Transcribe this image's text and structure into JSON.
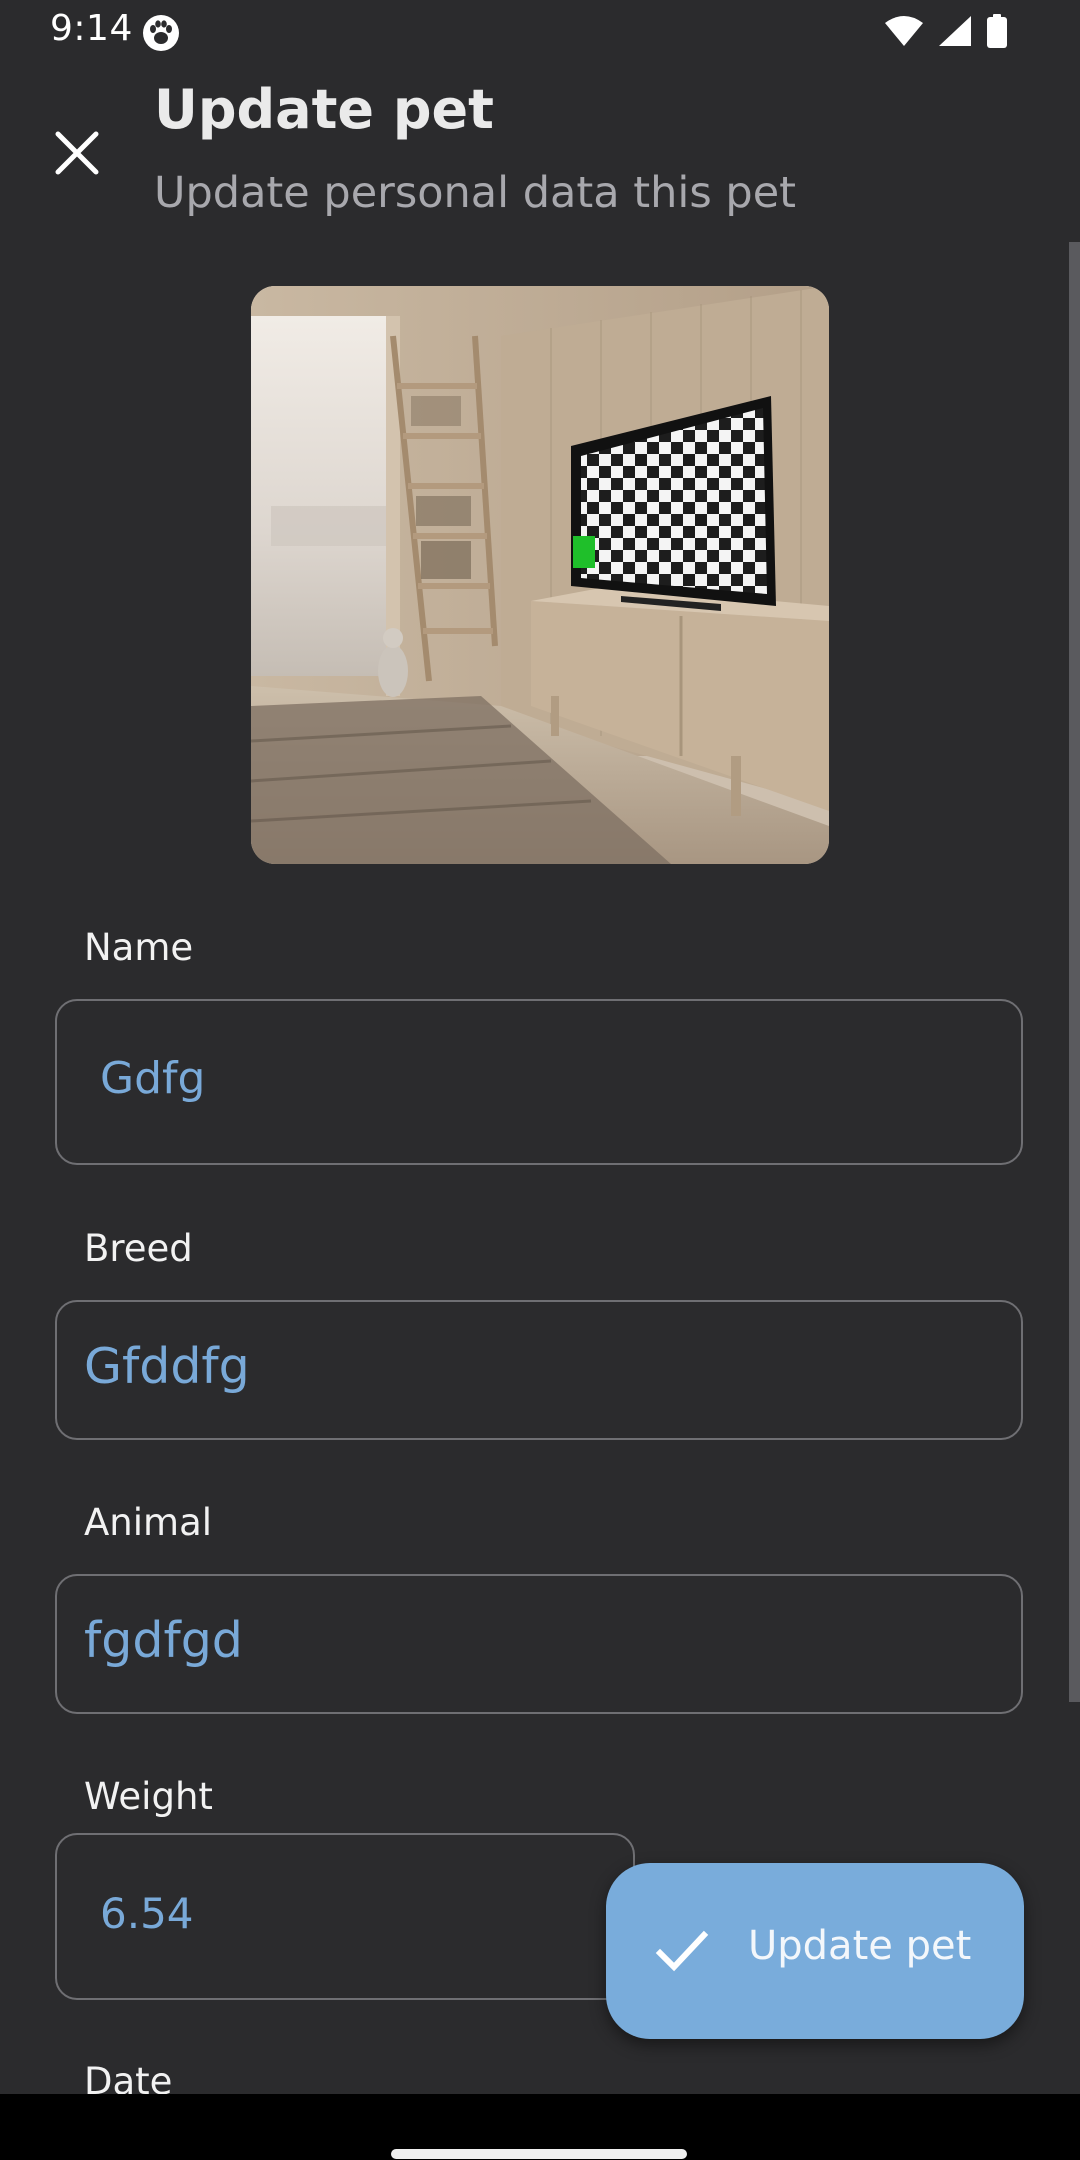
{
  "status_bar": {
    "time": "9:14",
    "left_icons": [
      "paw-icon"
    ],
    "right_icons": [
      "wifi-icon",
      "signal-icon",
      "battery-icon"
    ]
  },
  "header": {
    "close_icon": "close-icon",
    "title": "Update pet",
    "subtitle": "Update personal data this pet"
  },
  "photo": {
    "description_icon": "pet-photo"
  },
  "form": {
    "name": {
      "label": "Name",
      "value": "Gdfg"
    },
    "breed": {
      "label": "Breed",
      "value": "Gfddfg"
    },
    "animal": {
      "label": "Animal",
      "value": "fgdfgd"
    },
    "weight": {
      "label": "Weight",
      "value": "6.54"
    },
    "date": {
      "label": "Date"
    }
  },
  "fab": {
    "icon": "check-icon",
    "label": "Update pet"
  },
  "colors": {
    "background": "#2b2b2d",
    "accent": "#79acdb",
    "value_text": "#79a9d8",
    "field_border": "#6f6f73"
  }
}
